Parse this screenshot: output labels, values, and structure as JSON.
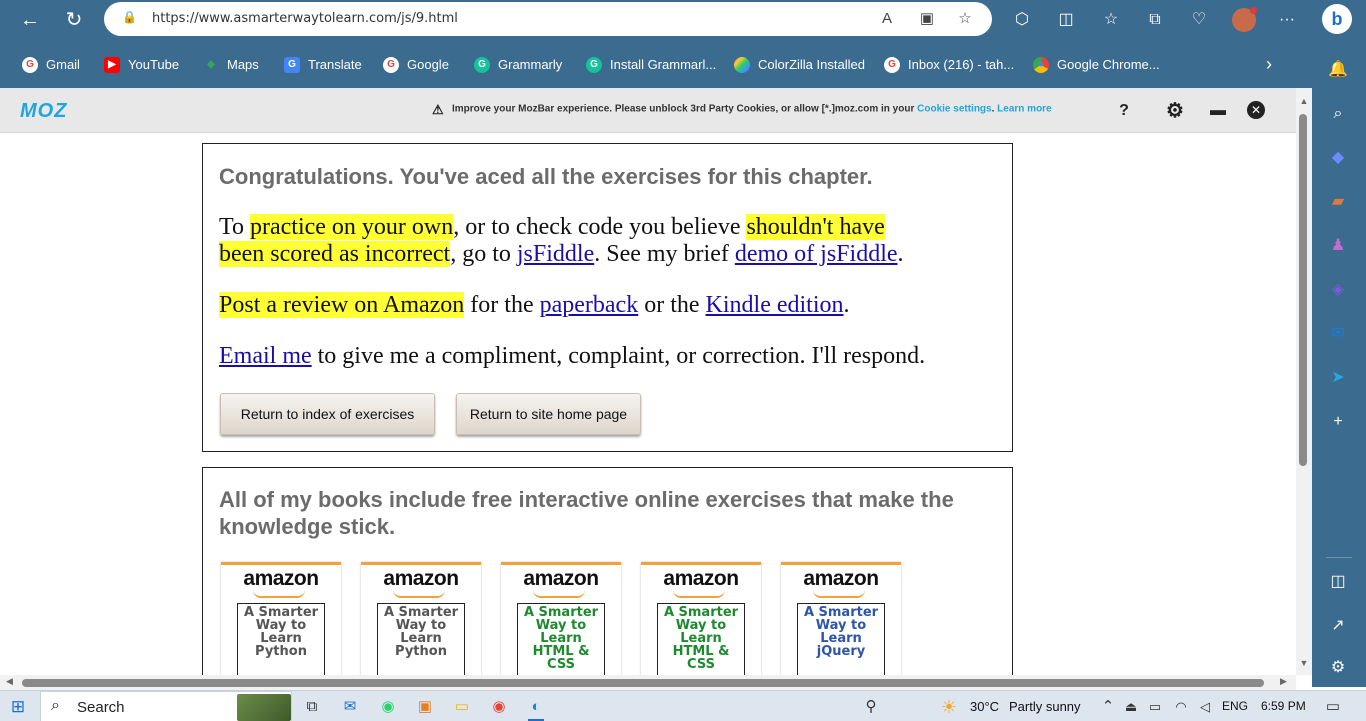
{
  "browser": {
    "url": "https://www.asmarterwaytolearn.com/js/9.html"
  },
  "bookmarks": [
    {
      "label": "Gmail",
      "color": "#ea4335",
      "glyph": "G"
    },
    {
      "label": "YouTube",
      "color": "#ff0000",
      "glyph": "▶"
    },
    {
      "label": "Maps",
      "color": "#34a853",
      "glyph": "◆"
    },
    {
      "label": "Translate",
      "color": "#4285f4",
      "glyph": "G"
    },
    {
      "label": "Google",
      "color": "#ea4335",
      "glyph": "G"
    },
    {
      "label": "Grammarly",
      "color": "#15c39a",
      "glyph": "G"
    },
    {
      "label": "Install Grammarl...",
      "color": "#15c39a",
      "glyph": "G"
    },
    {
      "label": "ColorZilla Installed",
      "color": "#b04bd8",
      "glyph": "●"
    },
    {
      "label": "Inbox (216) - tah...",
      "color": "#ea4335",
      "glyph": "G"
    },
    {
      "label": "Google Chrome...",
      "color": "#fbbc05",
      "glyph": "◉"
    }
  ],
  "mozbar": {
    "logo": "MOZ",
    "warning": "Improve your MozBar experience. Please unblock 3rd Party Cookies, or allow [*.]moz.com in your",
    "cookie_link": "Cookie settings",
    "separator": ".",
    "learn_more": "Learn more",
    "help": "?"
  },
  "page": {
    "congrats": "Congratulations. You've aced all the exercises for this chapter.",
    "p1": {
      "to": "To ",
      "hl1": "practice on your own",
      "mid": ", or to check code you believe ",
      "hl2a": "shouldn't have",
      "hl2b": "been scored as incorrect",
      "goto": ", go to ",
      "link1": "jsFiddle",
      "see": ". See my brief ",
      "link2": "demo of jsFiddle",
      "end": "."
    },
    "p2": {
      "hl": "Post a review on Amazon",
      "for": " for the ",
      "link1": "paperback",
      "or": " or the ",
      "link2": "Kindle edition",
      "end": "."
    },
    "p3": {
      "link": "Email me",
      "rest": " to give me a compliment, complaint, or correction. I'll respond."
    },
    "buttons": {
      "index": "Return to index of exercises",
      "home": "Return to site home page"
    },
    "books_title": " All of my books include free interactive online exercises that make the knowledge stick.",
    "books": [
      {
        "amazon": "amazon",
        "title": "A Smarter Way to Learn Python",
        "color": "#555555"
      },
      {
        "amazon": "amazon",
        "title": "A Smarter Way to Learn Python",
        "color": "#555555"
      },
      {
        "amazon": "amazon",
        "title": "A Smarter Way to Learn HTML & CSS",
        "color": "#1e8a2e"
      },
      {
        "amazon": "amazon",
        "title": "A Smarter Way to Learn HTML & CSS",
        "color": "#1e8a2e"
      },
      {
        "amazon": "amazon",
        "title": "A Smarter Way to Learn jQuery",
        "color": "#2d55a8"
      }
    ]
  },
  "taskbar": {
    "search": "Search",
    "weather_temp": "30°C",
    "weather_desc": "Partly sunny",
    "lang": "ENG",
    "time": "6:59 PM"
  }
}
